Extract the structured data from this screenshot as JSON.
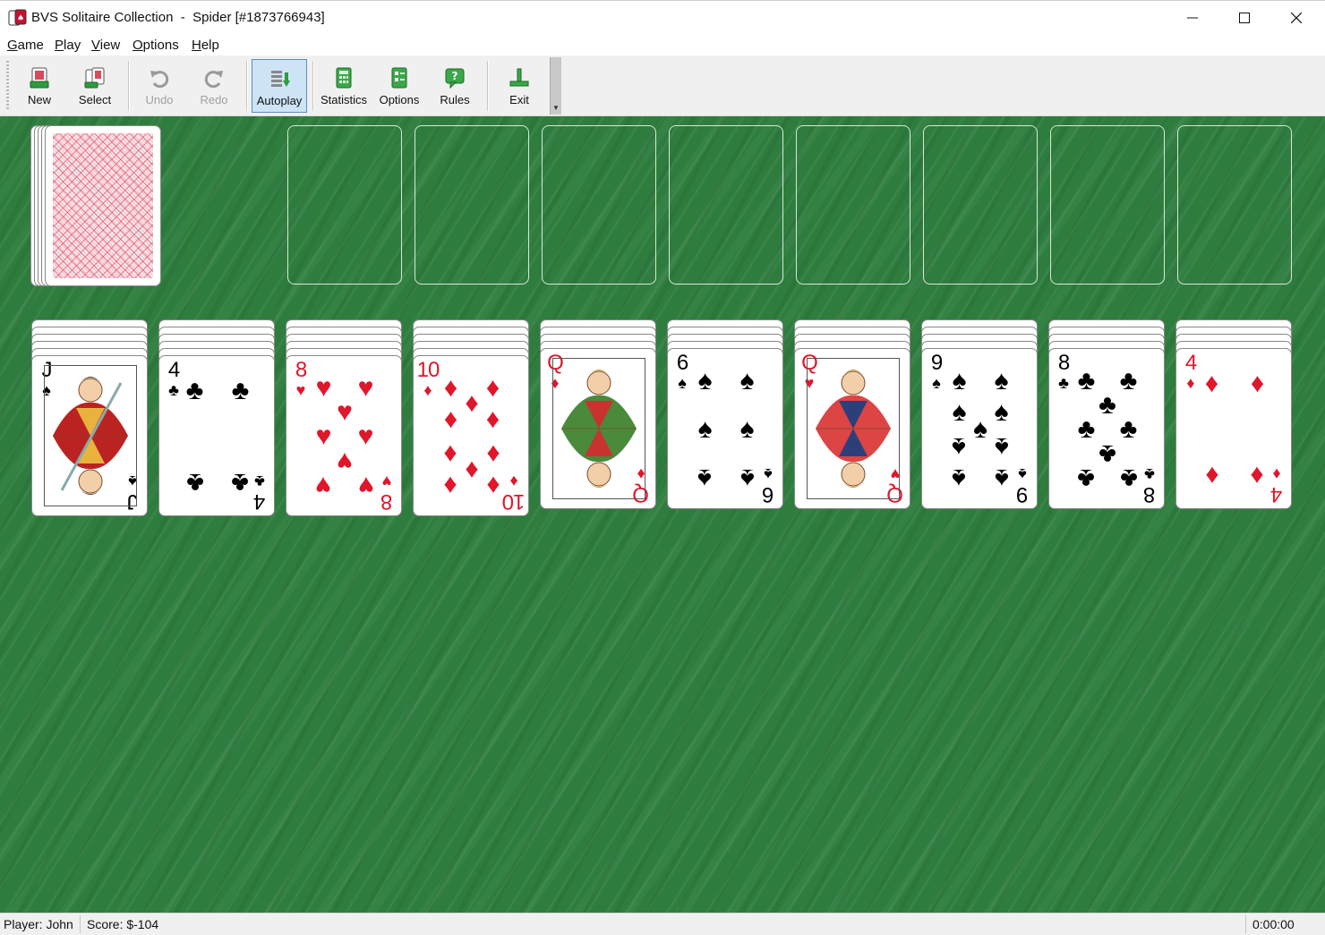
{
  "window": {
    "app_name": "BVS Solitaire Collection",
    "title_sep": "  -  ",
    "game_title": "Spider [#1873766943]"
  },
  "menu": [
    {
      "key": "G",
      "rest": "ame"
    },
    {
      "key": "P",
      "rest": "lay"
    },
    {
      "key": "V",
      "rest": "iew"
    },
    {
      "key": "O",
      "rest": "ptions"
    },
    {
      "key": "H",
      "rest": "elp"
    }
  ],
  "toolbar": {
    "new": "New",
    "select": "Select",
    "undo": "Undo",
    "redo": "Redo",
    "autoplay": "Autoplay",
    "statistics": "Statistics",
    "options": "Options",
    "rules": "Rules",
    "exit": "Exit"
  },
  "stock": {
    "remaining_stacks": 5
  },
  "foundation_slots": 8,
  "tableau": [
    {
      "face_down": 5,
      "top": {
        "rank": "J",
        "suit": "spades",
        "glyph": "♠",
        "color": "black"
      }
    },
    {
      "face_down": 5,
      "top": {
        "rank": "4",
        "suit": "clubs",
        "glyph": "♣",
        "color": "black"
      }
    },
    {
      "face_down": 5,
      "top": {
        "rank": "8",
        "suit": "hearts",
        "glyph": "♥",
        "color": "red"
      }
    },
    {
      "face_down": 5,
      "top": {
        "rank": "10",
        "suit": "diamonds",
        "glyph": "♦",
        "color": "red"
      }
    },
    {
      "face_down": 4,
      "top": {
        "rank": "Q",
        "suit": "diamonds",
        "glyph": "♦",
        "color": "red"
      }
    },
    {
      "face_down": 4,
      "top": {
        "rank": "6",
        "suit": "spades",
        "glyph": "♠",
        "color": "black"
      }
    },
    {
      "face_down": 4,
      "top": {
        "rank": "Q",
        "suit": "hearts",
        "glyph": "♥",
        "color": "red"
      }
    },
    {
      "face_down": 4,
      "top": {
        "rank": "9",
        "suit": "spades",
        "glyph": "♠",
        "color": "black"
      }
    },
    {
      "face_down": 4,
      "top": {
        "rank": "8",
        "suit": "clubs",
        "glyph": "♣",
        "color": "black"
      }
    },
    {
      "face_down": 4,
      "top": {
        "rank": "4",
        "suit": "diamonds",
        "glyph": "♦",
        "color": "red"
      }
    }
  ],
  "status": {
    "player": "Player: John",
    "score": "Score: $-104",
    "time": "0:00:00"
  },
  "colors": {
    "table_green": "#2e7d3e",
    "card_red": "#e0162b",
    "card_back_pink": "#d63c5a"
  }
}
